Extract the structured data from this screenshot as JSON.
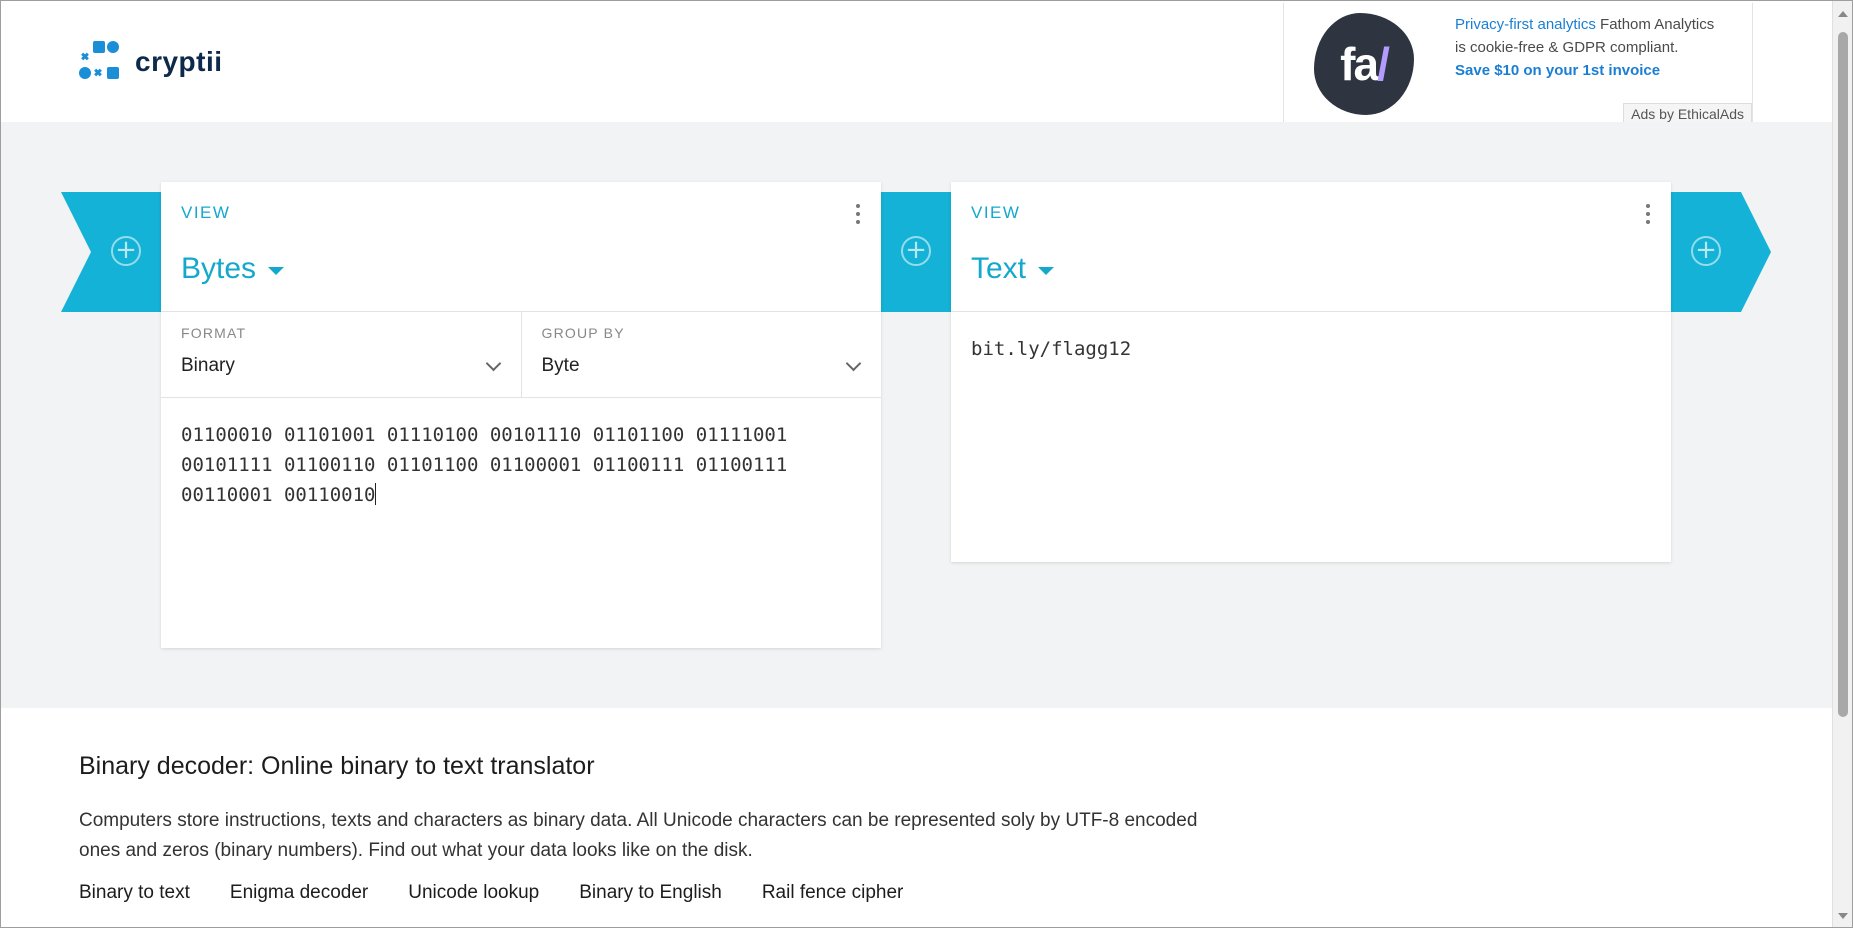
{
  "header": {
    "logo_text": "cryptii"
  },
  "ad": {
    "logo_text_a": "fa",
    "logo_text_b": "/",
    "highlight": "Privacy-first analytics",
    "text_1": " Fathom Analytics is cookie-free & GDPR compliant. ",
    "strong": "Save $10 on your 1st invoice",
    "badge": "Ads by EthicalAds"
  },
  "left_card": {
    "type_label": "VIEW",
    "name": "Bytes",
    "format_label": "FORMAT",
    "format_value": "Binary",
    "group_label": "GROUP BY",
    "group_value": "Byte",
    "content": "01100010 01101001 01110100 00101110 01101100 01111001\n00101111 01100110 01101100 01100001 01100111 01100111\n00110001 00110010"
  },
  "right_card": {
    "type_label": "VIEW",
    "name": "Text",
    "content": "bit.ly/flagg12"
  },
  "article": {
    "title": "Binary decoder: Online binary to text translator",
    "body": "Computers store instructions, texts and characters as binary data. All Unicode characters can be represented soly by UTF-8 encoded ones and zeros (binary numbers). Find out what your data looks like on the disk.",
    "links": [
      "Binary to text",
      "Enigma decoder",
      "Unicode lookup",
      "Binary to English",
      "Rail fence cipher"
    ]
  },
  "colors": {
    "accent": "#14b2d6",
    "workspace_bg": "#f2f3f4",
    "ad_link": "#1a7fd4"
  }
}
